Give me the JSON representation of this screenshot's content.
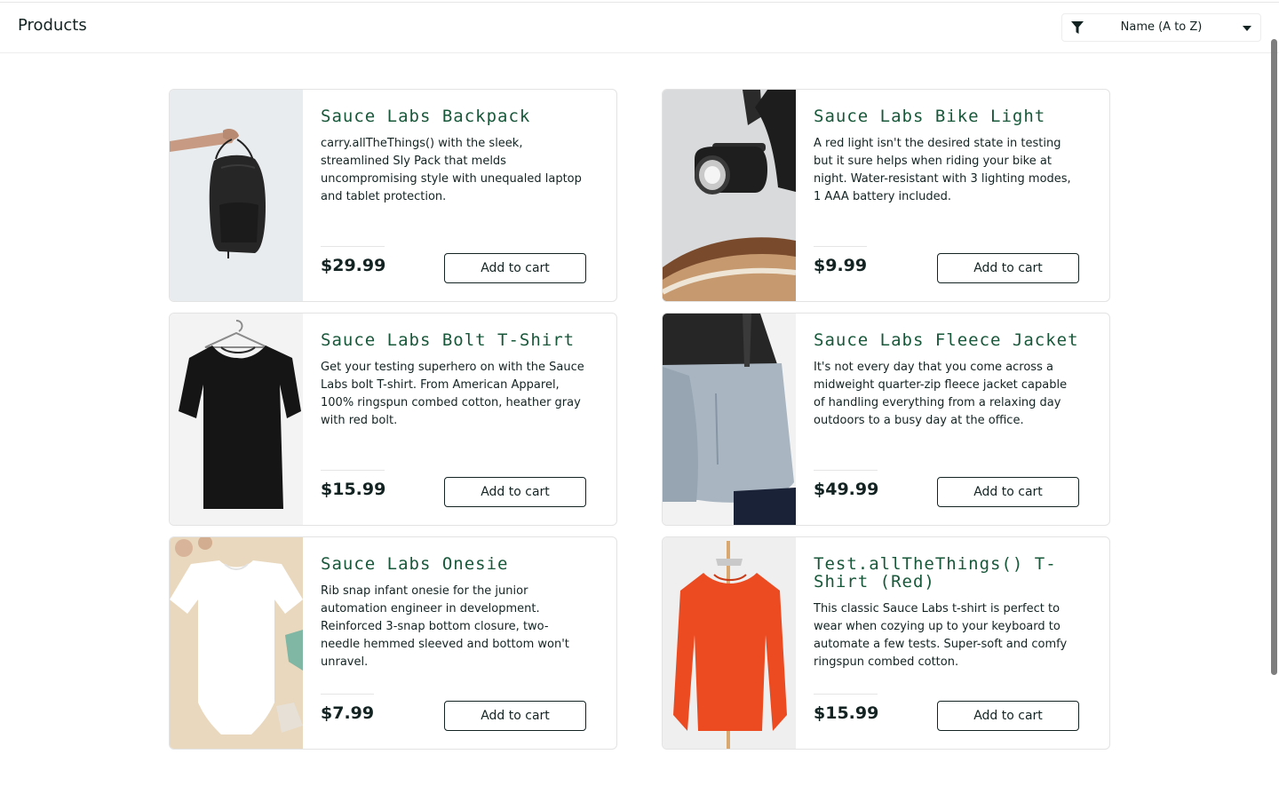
{
  "header": {
    "title": "Products",
    "sort": {
      "selected": "Name (A to Z)"
    }
  },
  "products": [
    {
      "name": "Sauce Labs Backpack",
      "description": "carry.allTheThings() with the sleek, streamlined Sly Pack that melds uncompromising style with unequaled laptop and tablet protection.",
      "price": "$29.99",
      "button": "Add to cart"
    },
    {
      "name": "Sauce Labs Bike Light",
      "description": "A red light isn't the desired state in testing but it sure helps when riding your bike at night. Water-resistant with 3 lighting modes, 1 AAA battery included.",
      "price": "$9.99",
      "button": "Add to cart"
    },
    {
      "name": "Sauce Labs Bolt T-Shirt",
      "description": "Get your testing superhero on with the Sauce Labs bolt T-shirt. From American Apparel, 100% ringspun combed cotton, heather gray with red bolt.",
      "price": "$15.99",
      "button": "Add to cart"
    },
    {
      "name": "Sauce Labs Fleece Jacket",
      "description": "It's not every day that you come across a midweight quarter-zip fleece jacket capable of handling everything from a relaxing day outdoors to a busy day at the office.",
      "price": "$49.99",
      "button": "Add to cart"
    },
    {
      "name": "Sauce Labs Onesie",
      "description": "Rib snap infant onesie for the junior automation engineer in development. Reinforced 3-snap bottom closure, two-needle hemmed sleeved and bottom won't unravel.",
      "price": "$7.99",
      "button": "Add to cart"
    },
    {
      "name": "Test.allTheThings() T-Shirt (Red)",
      "description": "This classic Sauce Labs t-shirt is perfect to wear when cozying up to your keyboard to automate a few tests. Super-soft and comfy ringspun combed cotton.",
      "price": "$15.99",
      "button": "Add to cart"
    }
  ],
  "colors": {
    "product_name": "#18583a",
    "text": "#132322",
    "border": "#e3e3e3"
  },
  "icons": [
    "filter-icon",
    "chevron-down-icon"
  ]
}
